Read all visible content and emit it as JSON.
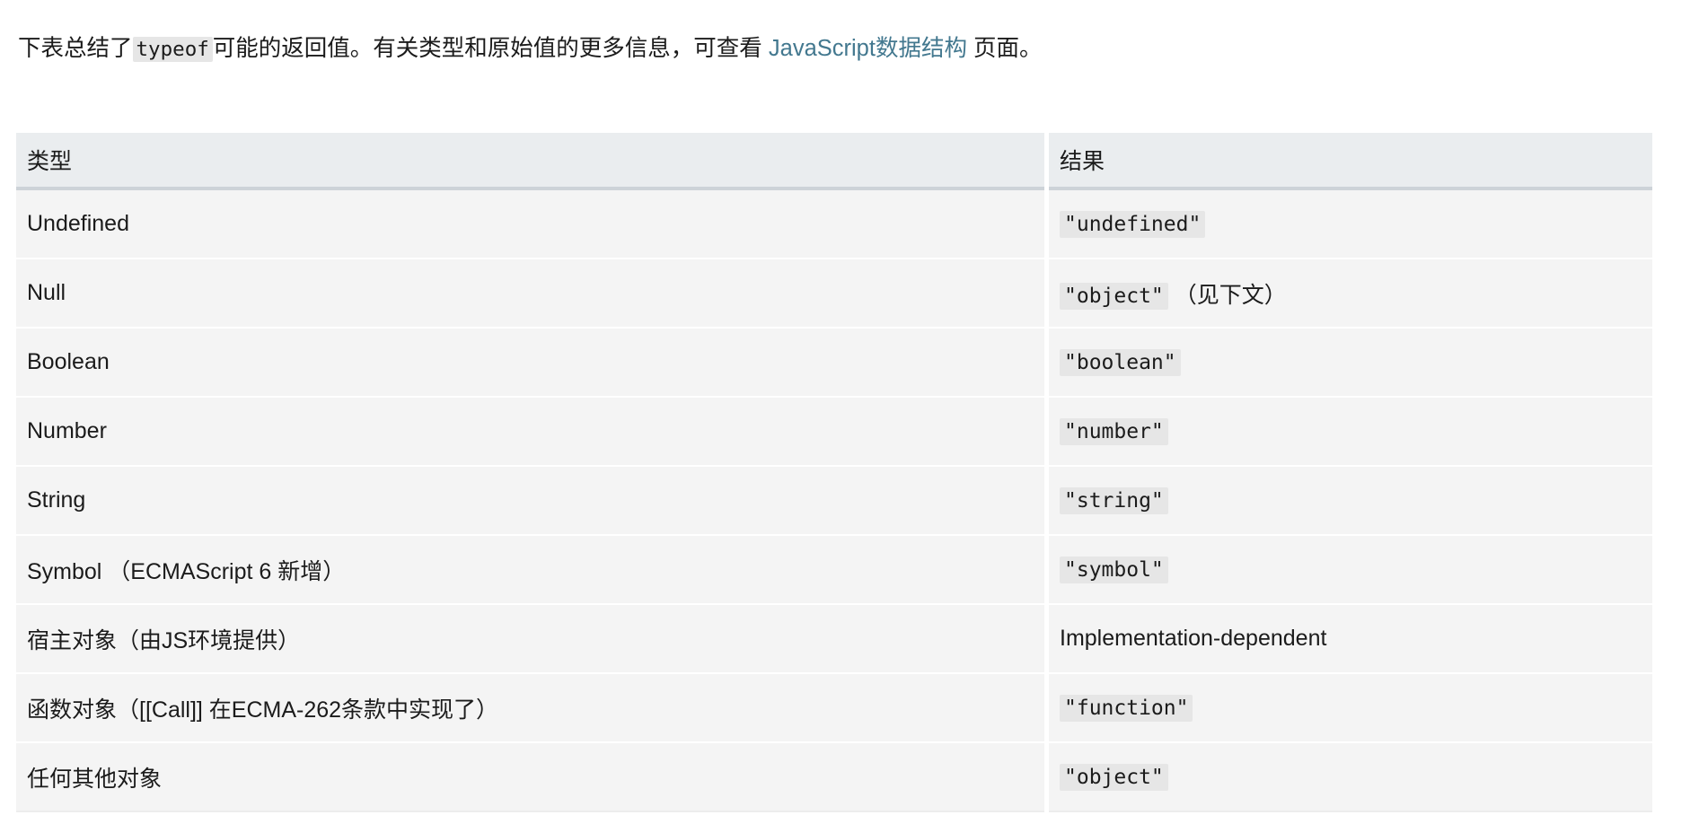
{
  "intro": {
    "before_code": "下表总结了",
    "code": "typeof",
    "after_code": "可能的返回值。有关类型和原始值的更多信息，可查看",
    "link_text": "JavaScript数据结构",
    "tail": "页面。",
    "link_color": "#43788f"
  },
  "table": {
    "headers": [
      "类型",
      "结果"
    ],
    "rows": [
      {
        "type": "Undefined",
        "result_code": "\"undefined\"",
        "result_note": "",
        "result_plain": ""
      },
      {
        "type": "Null",
        "result_code": "\"object\"",
        "result_note": "（见下文）",
        "result_plain": ""
      },
      {
        "type": "Boolean",
        "result_code": "\"boolean\"",
        "result_note": "",
        "result_plain": ""
      },
      {
        "type": "Number",
        "result_code": "\"number\"",
        "result_note": "",
        "result_plain": ""
      },
      {
        "type": "String",
        "result_code": "\"string\"",
        "result_note": "",
        "result_plain": ""
      },
      {
        "type": "Symbol （ECMAScript 6 新增）",
        "result_code": "\"symbol\"",
        "result_note": "",
        "result_plain": ""
      },
      {
        "type": "宿主对象（由JS环境提供）",
        "result_code": "",
        "result_note": "",
        "result_plain": "Implementation-dependent"
      },
      {
        "type": "函数对象（[[Call]] 在ECMA-262条款中实现了）",
        "result_code": "\"function\"",
        "result_note": "",
        "result_plain": ""
      },
      {
        "type": "任何其他对象",
        "result_code": "\"object\"",
        "result_note": "",
        "result_plain": ""
      }
    ]
  },
  "colors": {
    "header_bg": "#eaedef",
    "row_bg": "#f4f4f4",
    "code_bg": "#e6e6e6",
    "text": "#1b1b1b",
    "link": "#43788f",
    "header_border": "#cdd3d8"
  }
}
